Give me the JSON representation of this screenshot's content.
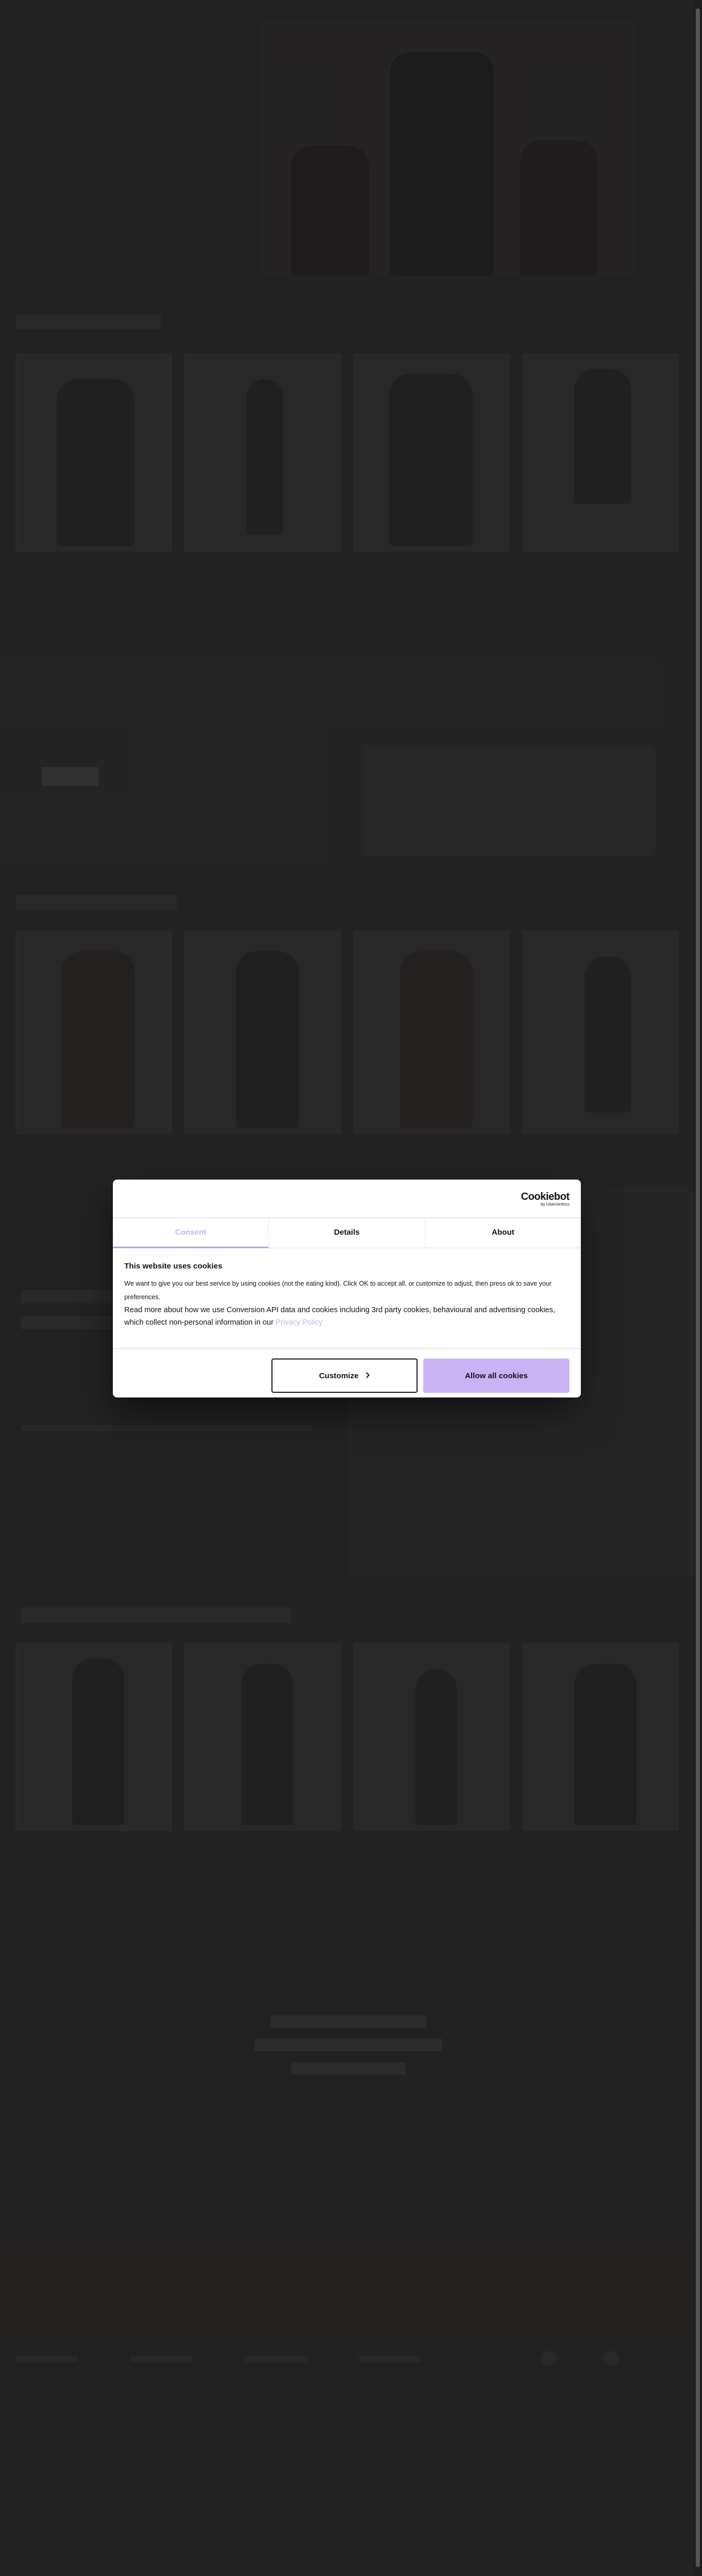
{
  "cookie_dialog": {
    "logo": {
      "main": "Cookiebot",
      "sub": "by Usercentrics"
    },
    "tabs": [
      {
        "label": "Consent",
        "active": true
      },
      {
        "label": "Details",
        "active": false
      },
      {
        "label": "About",
        "active": false
      }
    ],
    "title": "This website uses cookies",
    "paragraph1": "We want to give you our best service by using cookies (not the eating kind). Click OK to accept all, or customize to adjust, then press ok to save your preferences.",
    "paragraph2_prefix": "Read more about how we use Conversion API data and cookies including 3rd party cookies, behavioural and advertising cookies, which collect non-personal information in our ",
    "privacy_link": "Privacy Policy",
    "customize_label": "Customize",
    "customize_icon": "chevron-right-icon",
    "allow_label": "Allow all cookies"
  },
  "colors": {
    "accent": "#c9b3f5",
    "tab_active": "#c5b4f0",
    "backdrop": "#2a2a2a",
    "dialog_bg": "#ffffff"
  }
}
